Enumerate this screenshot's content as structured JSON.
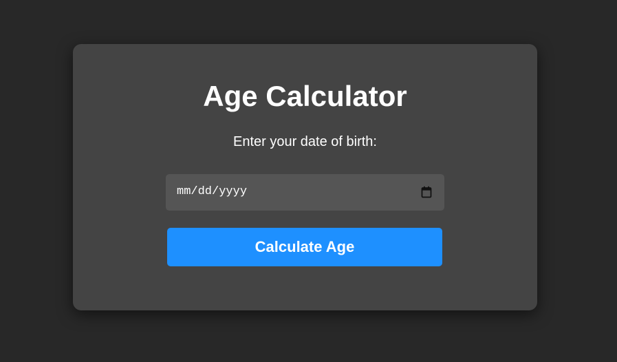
{
  "app": {
    "title": "Age Calculator",
    "prompt": "Enter your date of birth:"
  },
  "date_input": {
    "placeholder": "mm/dd/yyyy",
    "value": "",
    "icon": "calendar-icon"
  },
  "actions": {
    "calculate_label": "Calculate Age"
  },
  "colors": {
    "page_background": "#282828",
    "card_background": "#444444",
    "input_background": "#555555",
    "accent": "#1e90ff",
    "text": "#ffffff"
  }
}
